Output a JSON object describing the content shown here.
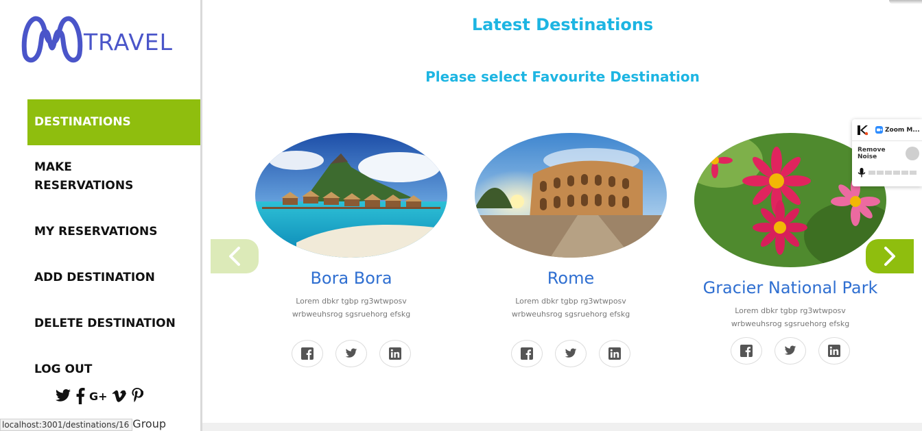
{
  "logo": {
    "text": "TRAVEL",
    "color": "#4a55c9"
  },
  "nav": {
    "items": [
      {
        "label": "DESTINATIONS",
        "active": true
      },
      {
        "label": "MAKE RESERVATIONS",
        "active": false
      },
      {
        "label": "MY RESERVATIONS",
        "active": false
      },
      {
        "label": "ADD DESTINATION",
        "active": false
      },
      {
        "label": "DELETE DESTINATION",
        "active": false
      },
      {
        "label": "LOG OUT",
        "active": false
      }
    ],
    "active_color": "#8fbe0e"
  },
  "social": [
    "twitter-icon",
    "facebook-icon",
    "google-plus-icon",
    "vimeo-icon",
    "pinterest-icon"
  ],
  "footer": {
    "copyright": "ivel Group"
  },
  "status_bar": {
    "url": "localhost:3001/destinations/16"
  },
  "main": {
    "title": "Latest Destinations",
    "subtitle": "Please select Favourite Destination",
    "title_color": "#1db5e2"
  },
  "cards": [
    {
      "name": "Bora Bora",
      "desc_line1": "Lorem dbkr tgbp rg3wtwposv",
      "desc_line2": "wrbweuhsrog sgsruehorg efskg"
    },
    {
      "name": "Rome",
      "desc_line1": "Lorem dbkr tgbp rg3wtwposv",
      "desc_line2": "wrbweuhsrog sgsruehorg efskg"
    },
    {
      "name": "Gracier National Park",
      "desc_line1": "Lorem dbkr tgbp rg3wtwposv",
      "desc_line2": "wrbweuhsrog sgsruehorg efskg"
    }
  ],
  "zoom_widget": {
    "tab_label": "Zoom M...",
    "remove_noise_label": "Remove Noise"
  }
}
